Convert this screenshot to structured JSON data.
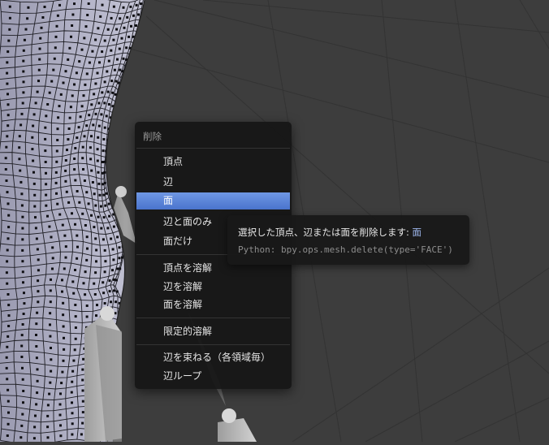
{
  "menu": {
    "title": "削除",
    "items": [
      {
        "label": "頂点"
      },
      {
        "label": "辺"
      },
      {
        "label": "面"
      },
      {
        "label": "辺と面のみ"
      },
      {
        "label": "面だけ"
      },
      {
        "label": "頂点を溶解"
      },
      {
        "label": "辺を溶解"
      },
      {
        "label": "面を溶解"
      },
      {
        "label": "限定的溶解"
      },
      {
        "label": "辺を束ねる（各領域毎）"
      },
      {
        "label": "辺ループ"
      }
    ],
    "active_item": "面"
  },
  "tooltip": {
    "description": "選択した頂点、辺または面を削除します:",
    "value": "面",
    "python": "Python: bpy.ops.mesh.delete(type='FACE')"
  },
  "colors": {
    "viewport_bg": "#3d3d3d",
    "mesh": "#b4b4c8",
    "menu_bg": "#161616",
    "highlight": "#5680d8"
  }
}
